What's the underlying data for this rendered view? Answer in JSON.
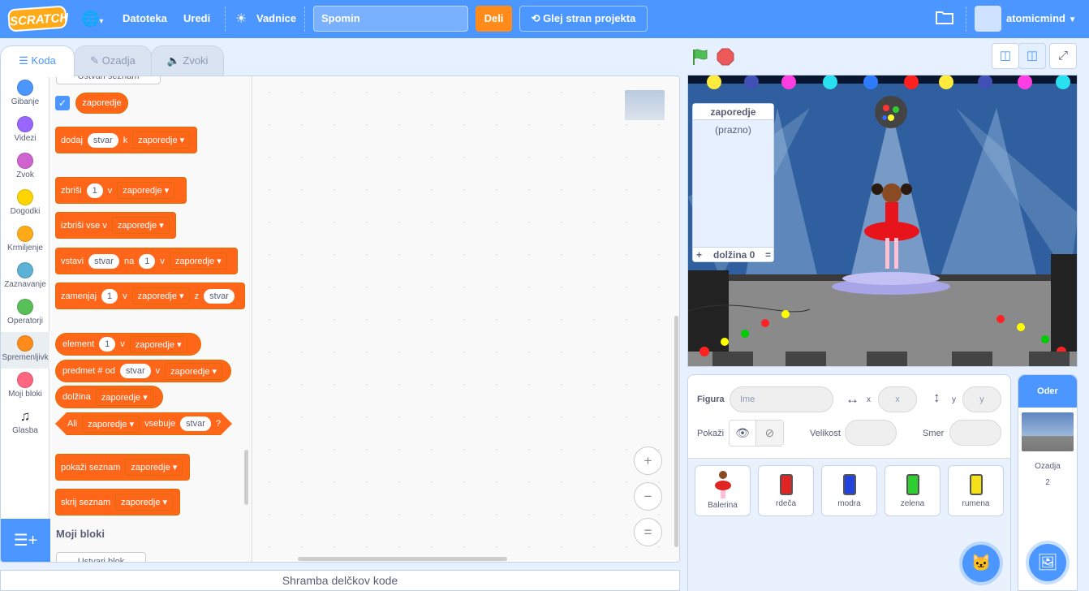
{
  "menubar": {
    "logo": "SCRATCH",
    "file": "Datoteka",
    "edit": "Uredi",
    "tutorials": "Vadnice",
    "project_title": "Spomin",
    "share": "Deli",
    "see_project": "Glej stran projekta",
    "username": "atomicmind"
  },
  "tabs": {
    "code": "Koda",
    "costumes": "Ozadja",
    "sounds": "Zvoki"
  },
  "categories": [
    {
      "label": "Gibanje",
      "color": "#4c97ff"
    },
    {
      "label": "Videzi",
      "color": "#9966ff"
    },
    {
      "label": "Zvok",
      "color": "#cf63cf"
    },
    {
      "label": "Dogodki",
      "color": "#ffd500"
    },
    {
      "label": "Krmiljenje",
      "color": "#ffab19"
    },
    {
      "label": "Zaznavanje",
      "color": "#5cb1d6"
    },
    {
      "label": "Operatorji",
      "color": "#59c059"
    },
    {
      "label": "Spremenljivk",
      "color": "#ff8c1a"
    },
    {
      "label": "Moji bloki",
      "color": "#ff6680"
    },
    {
      "label": "Glasba",
      "color": ""
    }
  ],
  "palette": {
    "make_list": "Ustvari seznam",
    "list_name": "zaporedje",
    "add": {
      "a": "dodaj",
      "item": "stvar",
      "b": "k"
    },
    "delete": {
      "a": "zbriši",
      "num": "1",
      "b": "v"
    },
    "delete_all": {
      "a": "izbriši vse v"
    },
    "insert": {
      "a": "vstavi",
      "item": "stvar",
      "b": "na",
      "num": "1",
      "c": "v"
    },
    "replace": {
      "a": "zamenjaj",
      "num": "1",
      "b": "v",
      "c": "z",
      "item": "stvar"
    },
    "item": {
      "a": "element",
      "num": "1",
      "b": "v"
    },
    "item_num": {
      "a": "predmet # od",
      "item": "stvar",
      "b": "v"
    },
    "length": {
      "a": "dolžina"
    },
    "contains": {
      "a": "Ali",
      "b": "vsebuje",
      "item": "stvar",
      "q": "?"
    },
    "show": {
      "a": "pokaži seznam"
    },
    "hide": {
      "a": "skrij seznam"
    },
    "my_blocks": "Moji bloki",
    "make_block": "Ustvari blok"
  },
  "zoom": {
    "in": "+",
    "out": "−",
    "reset": "="
  },
  "backpack": "Shramba delčkov kode",
  "list_monitor": {
    "title": "zaporedje",
    "empty": "(prazno)",
    "add": "+",
    "length": "dolžina 0",
    "resize": "="
  },
  "sprite_info": {
    "sprite_label": "Figura",
    "name_placeholder": "Ime",
    "x_label": "x",
    "x_placeholder": "x",
    "y_label": "y",
    "y_placeholder": "y",
    "show_label": "Pokaži",
    "size_label": "Velikost",
    "direction_label": "Smer"
  },
  "sprites": [
    {
      "name": "Balerina",
      "color": "#e02424"
    },
    {
      "name": "rdeča",
      "color": "#e02424"
    },
    {
      "name": "modra",
      "color": "#2244dd"
    },
    {
      "name": "zelena",
      "color": "#2fcf2f"
    },
    {
      "name": "rumena",
      "color": "#f5e11a"
    }
  ],
  "stage_pane": {
    "title": "Oder",
    "backdrops_label": "Ozadja",
    "backdrops_count": "2"
  }
}
